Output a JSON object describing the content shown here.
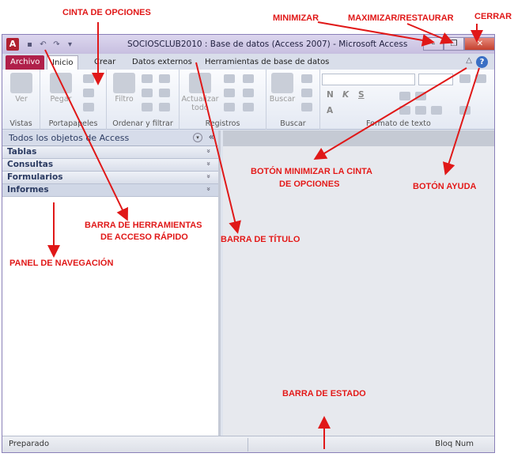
{
  "window": {
    "title": "SOCIOSCLUB2010 : Base de datos (Access 2007) - Microsoft Access",
    "logo": "A",
    "controls": {
      "minimize": "–",
      "restore": "❐",
      "close": "✕"
    }
  },
  "qat": {
    "save_icon": "▪",
    "undo_icon": "↶",
    "redo_icon": "↷",
    "customize_icon": "▾"
  },
  "tabs": [
    {
      "label": "Archivo"
    },
    {
      "label": "Inicio"
    },
    {
      "label": "Crear"
    },
    {
      "label": "Datos externos"
    },
    {
      "label": "Herramientas de base de datos"
    }
  ],
  "ribbon": {
    "groups": [
      {
        "label": "Vistas",
        "buttons": [
          "Ver"
        ]
      },
      {
        "label": "Portapapeles",
        "buttons": [
          "Pegar"
        ]
      },
      {
        "label": "Ordenar y filtrar",
        "buttons": [
          "Filtro"
        ]
      },
      {
        "label": "Registros",
        "buttons": [
          "Actualizar",
          "todo"
        ]
      },
      {
        "label": "Buscar",
        "buttons": [
          "Buscar"
        ]
      },
      {
        "label": "Formato de texto",
        "buttons": []
      }
    ],
    "minimize_icon": "△",
    "help_icon": "?",
    "format_glyphs": [
      "N",
      "K",
      "S",
      "A"
    ]
  },
  "nav": {
    "title": "Todos los objetos de Access",
    "dropdown_icon": "▾",
    "collapse_icon": "«",
    "groups": [
      {
        "label": "Tablas"
      },
      {
        "label": "Consultas"
      },
      {
        "label": "Formularios"
      },
      {
        "label": "Informes"
      }
    ],
    "chevron": "»"
  },
  "status": {
    "left": "Preparado",
    "right": "Bloq Num"
  },
  "annotations": {
    "cinta": "CINTA DE OPCIONES",
    "minimizar": "MINIMIZAR",
    "maximizar": "MAXIMIZAR/RESTAURAR",
    "cerrar": "CERRAR",
    "boton_min_cinta_1": "BOTÓN MINIMIZAR LA CINTA",
    "boton_min_cinta_2": "DE OPCIONES",
    "boton_ayuda": "BOTÓN AYUDA",
    "barra_herr_1": "BARRA DE HERRAMIENTAS",
    "barra_herr_2": "DE ACCESO RÁPIDO",
    "barra_titulo": "BARRA DE TÍTULO",
    "panel_nav": "PANEL DE NAVEGACIÓN",
    "barra_estado": "BARRA DE ESTADO"
  },
  "colors": {
    "annotation": "#e01818",
    "file_tab": "#b0204a",
    "accent": "#3a6fc4"
  }
}
